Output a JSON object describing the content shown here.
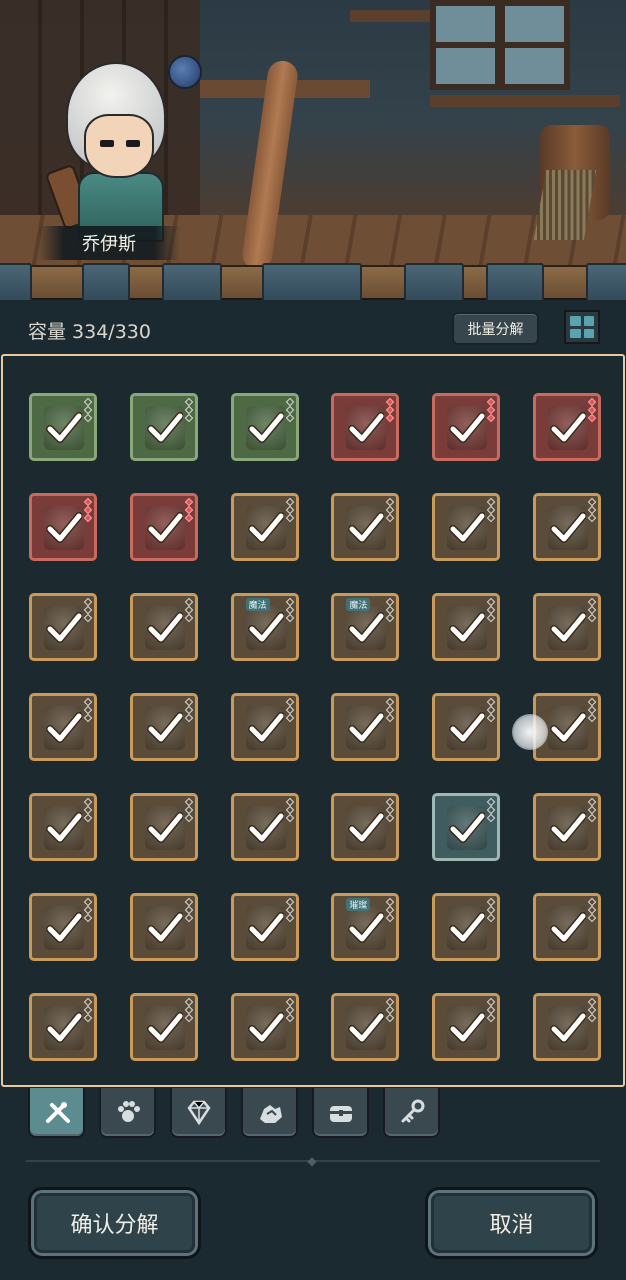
{
  "hero": {
    "name": "乔伊斯"
  },
  "inventory": {
    "capacity_label": "容量 334/330",
    "batch_button": "批量分解",
    "view_toggle_icon": "grid-view-icon",
    "items": [
      {
        "rarity": "green",
        "kind": "bow",
        "gems": 3,
        "tag": ""
      },
      {
        "rarity": "green",
        "kind": "arrow",
        "gems": 3,
        "tag": ""
      },
      {
        "rarity": "green",
        "kind": "boots",
        "gems": 3,
        "tag": ""
      },
      {
        "rarity": "red",
        "kind": "crossbow",
        "gems": 3,
        "tag": ""
      },
      {
        "rarity": "red",
        "kind": "crossbow",
        "gems": 3,
        "tag": ""
      },
      {
        "rarity": "red",
        "kind": "crossbow",
        "gems": 3,
        "tag": ""
      },
      {
        "rarity": "red",
        "kind": "bow",
        "gems": 3,
        "tag": ""
      },
      {
        "rarity": "red",
        "kind": "bow",
        "gems": 3,
        "tag": ""
      },
      {
        "rarity": "gold",
        "kind": "golden-bow",
        "gems": 3,
        "tag": ""
      },
      {
        "rarity": "gold",
        "kind": "golden-bow",
        "gems": 3,
        "tag": ""
      },
      {
        "rarity": "gold",
        "kind": "skeleton-bow",
        "gems": 3,
        "tag": ""
      },
      {
        "rarity": "gold",
        "kind": "skeleton-bow",
        "gems": 3,
        "tag": ""
      },
      {
        "rarity": "gold",
        "kind": "crystal-sword",
        "gems": 3,
        "tag": ""
      },
      {
        "rarity": "gold",
        "kind": "crystal-sword",
        "gems": 3,
        "tag": ""
      },
      {
        "rarity": "gold",
        "kind": "staff",
        "gems": 3,
        "tag": "魔法"
      },
      {
        "rarity": "gold",
        "kind": "staff",
        "gems": 3,
        "tag": "魔法"
      },
      {
        "rarity": "gold",
        "kind": "scythe",
        "gems": 3,
        "tag": ""
      },
      {
        "rarity": "gold",
        "kind": "crown-staff",
        "gems": 3,
        "tag": ""
      },
      {
        "rarity": "gold",
        "kind": "dark-armor",
        "gems": 3,
        "tag": ""
      },
      {
        "rarity": "gold",
        "kind": "dark-armor",
        "gems": 3,
        "tag": ""
      },
      {
        "rarity": "gold",
        "kind": "dark-armor",
        "gems": 3,
        "tag": ""
      },
      {
        "rarity": "gold",
        "kind": "silver-armor",
        "gems": 3,
        "tag": ""
      },
      {
        "rarity": "gold",
        "kind": "silver-armor",
        "gems": 3,
        "tag": ""
      },
      {
        "rarity": "gold",
        "kind": "silver-armor",
        "gems": 3,
        "tag": ""
      },
      {
        "rarity": "gold",
        "kind": "cloak",
        "gems": 3,
        "tag": ""
      },
      {
        "rarity": "gold",
        "kind": "cloak",
        "gems": 3,
        "tag": ""
      },
      {
        "rarity": "gold",
        "kind": "robe",
        "gems": 3,
        "tag": ""
      },
      {
        "rarity": "gold",
        "kind": "robe",
        "gems": 3,
        "tag": ""
      },
      {
        "rarity": "teal",
        "kind": "vest",
        "gems": 3,
        "tag": ""
      },
      {
        "rarity": "gold",
        "kind": "bracer",
        "gems": 3,
        "tag": ""
      },
      {
        "rarity": "gold",
        "kind": "bracer",
        "gems": 3,
        "tag": ""
      },
      {
        "rarity": "gold",
        "kind": "bracer",
        "gems": 3,
        "tag": ""
      },
      {
        "rarity": "gold",
        "kind": "bracer",
        "gems": 3,
        "tag": ""
      },
      {
        "rarity": "gold",
        "kind": "bracer",
        "gems": 3,
        "tag": "璀璨"
      },
      {
        "rarity": "gold",
        "kind": "boots",
        "gems": 3,
        "tag": ""
      },
      {
        "rarity": "gold",
        "kind": "boots",
        "gems": 3,
        "tag": ""
      },
      {
        "rarity": "gold",
        "kind": "boots",
        "gems": 3,
        "tag": ""
      },
      {
        "rarity": "gold",
        "kind": "boots",
        "gems": 3,
        "tag": ""
      },
      {
        "rarity": "gold",
        "kind": "boots",
        "gems": 3,
        "tag": ""
      },
      {
        "rarity": "gold",
        "kind": "boots",
        "gems": 3,
        "tag": ""
      },
      {
        "rarity": "gold",
        "kind": "winged-boots",
        "gems": 3,
        "tag": ""
      },
      {
        "rarity": "gold",
        "kind": "winged-boots",
        "gems": 3,
        "tag": ""
      }
    ]
  },
  "tabs": [
    {
      "icon": "weapons-icon",
      "active": true
    },
    {
      "icon": "paw-icon",
      "active": false
    },
    {
      "icon": "gem-icon",
      "active": false
    },
    {
      "icon": "ore-icon",
      "active": false
    },
    {
      "icon": "chest-icon",
      "active": false
    },
    {
      "icon": "key-icon",
      "active": false
    }
  ],
  "actions": {
    "confirm": "确认分解",
    "cancel": "取消"
  },
  "colors": {
    "panel_border": "#e6c9a0",
    "active_tab": "#5c8c90",
    "background": "#1b2a30"
  }
}
